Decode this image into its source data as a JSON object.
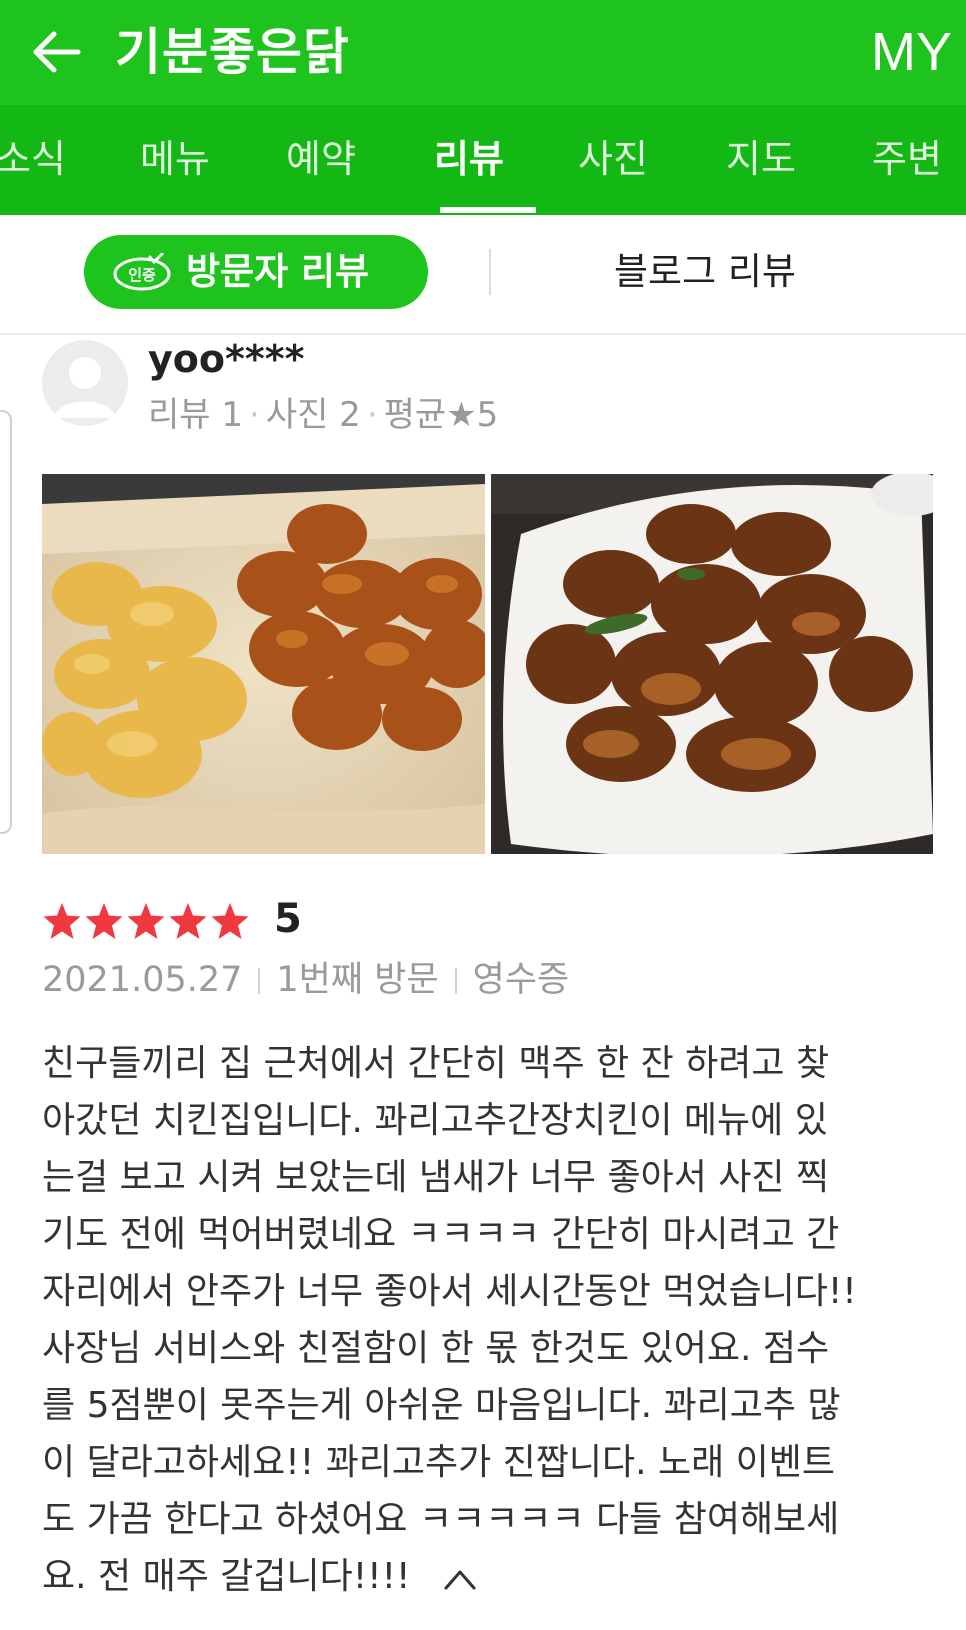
{
  "header": {
    "title": "기분좋은닭",
    "my_label": "MY",
    "colors": {
      "brand_green": "#1ec31e",
      "tab_green": "#14b814"
    }
  },
  "tabs": [
    {
      "label": "소식"
    },
    {
      "label": "메뉴"
    },
    {
      "label": "예약"
    },
    {
      "label": "리뷰",
      "active": true
    },
    {
      "label": "사진"
    },
    {
      "label": "지도"
    },
    {
      "label": "주변"
    }
  ],
  "review_type": {
    "visitor_label": "방문자 리뷰",
    "badge_text": "인증",
    "blog_label": "블로그 리뷰"
  },
  "review": {
    "username": "yoo****",
    "stats": {
      "reviews": "리뷰 1",
      "photos": "사진 2",
      "average": "평균★5"
    },
    "rating": 5,
    "score_label": "5",
    "date": "2021.05.27",
    "visit": "1번째 방문",
    "proof": "영수증",
    "text": "친구들끼리 집 근처에서 간단히 맥주 한 잔 하려고 찾\n아갔던 치킨집입니다. 꽈리고추간장치킨이 메뉴에 있\n는걸 보고 시켜 보았는데 냄새가 너무 좋아서 사진 찍\n기도 전에 먹어버렸네요 ㅋㅋㅋㅋ 간단히 마시려고 간\n자리에서 안주가 너무 좋아서 세시간동안 먹었습니다!!\n사장님 서비스와 친절함이 한 몫 한것도 있어요. 점수\n를 5점뿐이 못주는게 아쉬운 마음입니다. 꽈리고추 많\n이 달라고하세요!! 꽈리고추가 진짭니다. 노래 이벤트\n도 가끔 한다고 하셨어요 ㅋㅋㅋㅋㅋ 다들 참여해보세\n요. 전 매주 갈겁니다!!!!",
    "colors": {
      "star": "#f0393f",
      "meta_gray": "#9a9a9a"
    }
  },
  "icons": {
    "back": "arrow-left-icon",
    "collapse": "chevron-up-icon",
    "star": "star-icon",
    "avatar": "default-user-icon",
    "badge": "verified-badge-icon"
  }
}
